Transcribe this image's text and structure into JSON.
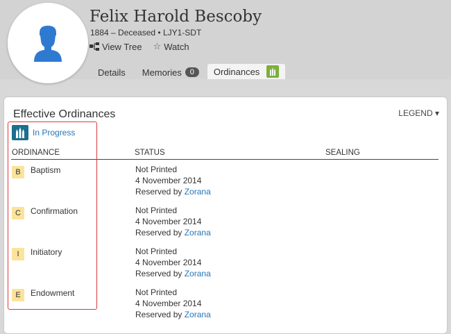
{
  "person": {
    "name": "Felix Harold Bescoby",
    "meta": "1884 – Deceased • LJY1-SDT"
  },
  "actions": {
    "view_tree": "View Tree",
    "watch": "Watch"
  },
  "tabs": [
    {
      "label": "Details"
    },
    {
      "label": "Memories",
      "count": "0"
    },
    {
      "label": "Ordinances",
      "active": true
    }
  ],
  "card": {
    "title": "Effective Ordinances",
    "legend": "LEGEND ▾",
    "progress_label": "In Progress",
    "columns": {
      "ordinance": "ORDINANCE",
      "status": "STATUS",
      "sealing": "SEALING"
    }
  },
  "ordinances": [
    {
      "letter": "B",
      "name": "Baptism",
      "status": "Not Printed",
      "date": "4 November 2014",
      "reserved_prefix": "Reserved by",
      "reserved_by": "Zorana"
    },
    {
      "letter": "C",
      "name": "Confirmation",
      "status": "Not Printed",
      "date": "4 November 2014",
      "reserved_prefix": "Reserved by",
      "reserved_by": "Zorana"
    },
    {
      "letter": "I",
      "name": "Initiatory",
      "status": "Not Printed",
      "date": "4 November 2014",
      "reserved_prefix": "Reserved by",
      "reserved_by": "Zorana"
    },
    {
      "letter": "E",
      "name": "Endowment",
      "status": "Not Printed",
      "date": "4 November 2014",
      "reserved_prefix": "Reserved by",
      "reserved_by": "Zorana"
    }
  ],
  "colors": {
    "link": "#2474b8",
    "temple_teal": "#1b6f90",
    "temple_green": "#7bb03c",
    "letter_bg": "#fbe39b",
    "highlight": "#d93a3a"
  }
}
